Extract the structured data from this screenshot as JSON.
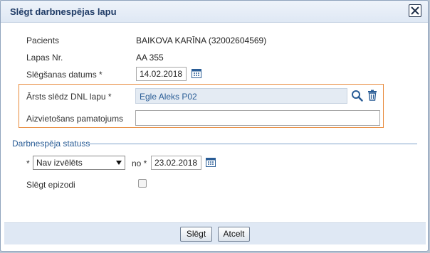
{
  "dialog": {
    "title": "Slēgt darbnespējas lapu"
  },
  "patient": {
    "label": "Pacients",
    "value": "BAIKOVA KARĪNA (32002604569)"
  },
  "sheet": {
    "label": "Lapas Nr.",
    "value": "AA 355"
  },
  "closing_date": {
    "label": "Slēgšanas datums *",
    "value": "14.02.2018"
  },
  "doctor": {
    "label": "Ārsts slēdz DNL lapu *",
    "value": "Egle Aleks P02"
  },
  "substitution": {
    "label": "Aizvietošans pamatojums",
    "value": ""
  },
  "status_section": {
    "title": "Darbnespēja statuss",
    "required_mark": "*",
    "selected_status": "Nav izvēlēts",
    "from_label": "no *",
    "from_date": "23.02.2018"
  },
  "episodes": {
    "label": "Slēgt epizodi"
  },
  "footer": {
    "close_label": "Slēgt",
    "cancel_label": "Atcelt"
  },
  "icons": {
    "close": "close-icon",
    "calendar": "calendar-icon",
    "search": "search-icon",
    "delete": "trash-icon"
  },
  "colors": {
    "title": "#1f3b66",
    "accent": "#2a5d96",
    "highlight_border": "#e8893a"
  }
}
